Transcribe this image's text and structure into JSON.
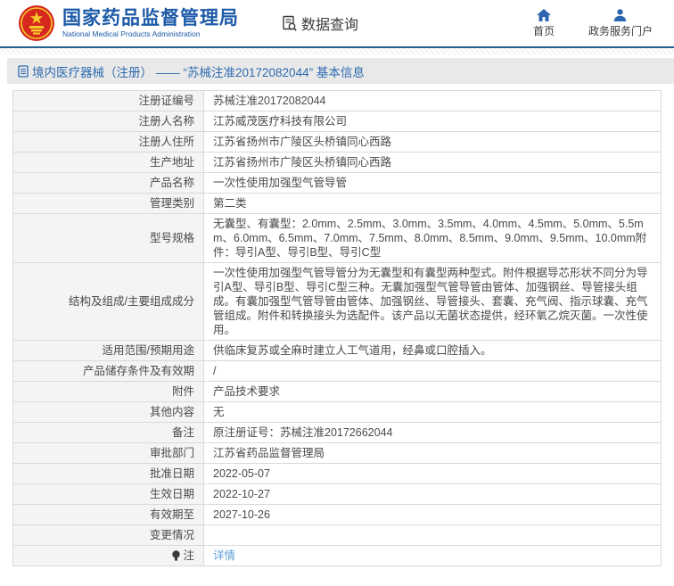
{
  "header": {
    "agency_cn": "国家药品监督管理局",
    "agency_en": "National Medical Products Administration",
    "query_label": "数据查询",
    "nav": [
      {
        "label": "首页",
        "icon": "home-icon"
      },
      {
        "label": "政务服务门户",
        "icon": "person-icon"
      }
    ]
  },
  "colors": {
    "brand_blue": "#1d5aa8",
    "nav_icon_blue": "#2d66b0",
    "header_rule_teal": "#21618c",
    "breadcrumb_bg": "#e9e9e9",
    "label_cell_bg": "#f4f4f4",
    "border_gray": "#d9d9d9",
    "link_blue": "#5e9ed6",
    "emblem_red": "#d6281e",
    "emblem_gold": "#f7c92a"
  },
  "breadcrumb": {
    "icon": "document-icon",
    "text": "境内医疗器械（注册） —— “苏械注准20172082044” 基本信息"
  },
  "table": {
    "rows": [
      {
        "label": "注册证编号",
        "value": "苏械注准20172082044"
      },
      {
        "label": "注册人名称",
        "value": "江苏威茂医疗科技有限公司"
      },
      {
        "label": "注册人住所",
        "value": "江苏省扬州市广陵区头桥镇同心西路"
      },
      {
        "label": "生产地址",
        "value": "江苏省扬州市广陵区头桥镇同心西路"
      },
      {
        "label": "产品名称",
        "value": "一次性使用加强型气管导管"
      },
      {
        "label": "管理类别",
        "value": "第二类"
      },
      {
        "label": "型号规格",
        "value": "无囊型、有囊型：2.0mm、2.5mm、3.0mm、3.5mm、4.0mm、4.5mm、5.0mm、5.5mm、6.0mm、6.5mm、7.0mm、7.5mm、8.0mm、8.5mm、9.0mm、9.5mm、10.0mm附件：导引A型、导引B型、导引C型",
        "multiline": true
      },
      {
        "label": "结构及组成/主要组成成分",
        "value": "一次性使用加强型气管导管分为无囊型和有囊型两种型式。附件根据导芯形状不同分为导引A型、导引B型、导引C型三种。无囊加强型气管导管由管体、加强钢丝、导管接头组成。有囊加强型气管导管由管体、加强钢丝、导管接头、套囊、充气阀、指示球囊、充气管组成。附件和转换接头为选配件。该产品以无菌状态提供，经环氧乙烷灭菌。一次性使用。",
        "multiline": true
      },
      {
        "label": "适用范围/预期用途",
        "value": "供临床复苏或全麻时建立人工气道用，经鼻或口腔插入。"
      },
      {
        "label": "产品储存条件及有效期",
        "value": "/"
      },
      {
        "label": "附件",
        "value": "产品技术要求"
      },
      {
        "label": "其他内容",
        "value": "无"
      },
      {
        "label": "备注",
        "value": "原注册证号：苏械注准20172662044"
      },
      {
        "label": "审批部门",
        "value": "江苏省药品监督管理局"
      },
      {
        "label": "批准日期",
        "value": "2022-05-07"
      },
      {
        "label": "生效日期",
        "value": "2022-10-27"
      },
      {
        "label": "有效期至",
        "value": "2027-10-26"
      },
      {
        "label": "变更情况",
        "value": ""
      },
      {
        "label": "注",
        "value": "详情",
        "link": true,
        "label_icon": "bulb-icon"
      }
    ]
  }
}
